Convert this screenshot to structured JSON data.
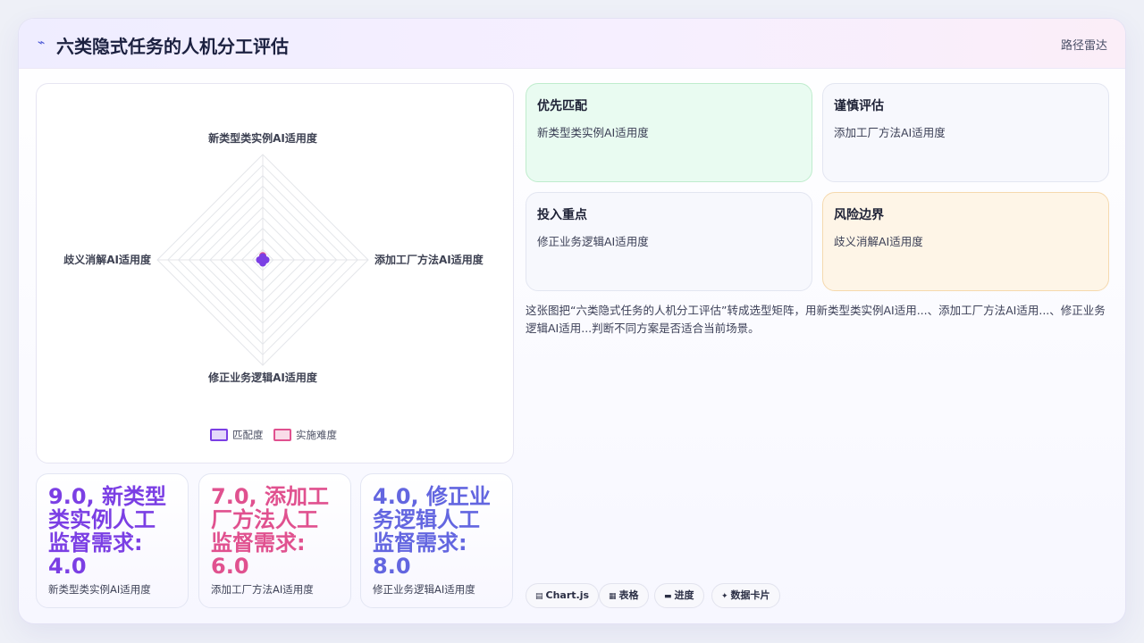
{
  "header": {
    "icon": "sparkline-icon",
    "title": "六类隐式任务的人机分工评估",
    "tag": "路径雷达"
  },
  "chart_data": {
    "type": "radar",
    "axes": [
      "新类型类实例AI适用度",
      "添加工厂方法AI适用度",
      "修正业务逻辑AI适用度",
      "歧义消解AI适用度"
    ],
    "range": [
      0,
      10
    ],
    "grid": true,
    "legend_position": "bottom",
    "series": [
      {
        "name": "匹配度",
        "color": "#7b3fe4",
        "values": [
          0.3,
          0.3,
          0.3,
          0.3
        ]
      },
      {
        "name": "实施难度",
        "color": "#e0518f",
        "values": [
          0.4,
          0.2,
          0.2,
          0.2
        ]
      }
    ]
  },
  "stats": [
    {
      "value": "9.0, 新类型类实例人工监督需求: 4.0",
      "label": "新类型类实例AI适用度",
      "color": "#7b3fe4"
    },
    {
      "value": "7.0, 添加工厂方法人工监督需求: 6.0",
      "label": "添加工厂方法AI适用度",
      "color": "#e0518f"
    },
    {
      "value": "4.0, 修正业务逻辑人工监督需求: 8.0",
      "label": "修正业务逻辑AI适用度",
      "color": "#6366e0"
    }
  ],
  "quadrants": [
    {
      "title": "优先匹配",
      "text": "新类型类实例AI适用度",
      "bg": "#e9fbf1",
      "border": "#bfeccd"
    },
    {
      "title": "谨慎评估",
      "text": "添加工厂方法AI适用度",
      "bg": "#f7f8fd",
      "border": "#e3e6f1"
    },
    {
      "title": "投入重点",
      "text": "修正业务逻辑AI适用度",
      "bg": "#f7f8fd",
      "border": "#e3e6f1"
    },
    {
      "title": "风险边界",
      "text": "歧义消解AI适用度",
      "bg": "#fef5e7",
      "border": "#f5d9ae"
    }
  ],
  "description": "这张图把“六类隐式任务的人机分工评估”转成选型矩阵，用新类型类实例AI适用...、添加工厂方法AI适用...、修正业务逻辑AI适用...判断不同方案是否适合当前场景。",
  "chips": [
    {
      "icon": "chart-icon",
      "glyph": "▤",
      "label": "Chart.js"
    },
    {
      "icon": "table-icon",
      "glyph": "▦",
      "label": "表格"
    },
    {
      "icon": "progress-icon",
      "glyph": "▬",
      "label": "进度"
    },
    {
      "icon": "sparkle-icon",
      "glyph": "✦",
      "label": "数据卡片"
    }
  ]
}
